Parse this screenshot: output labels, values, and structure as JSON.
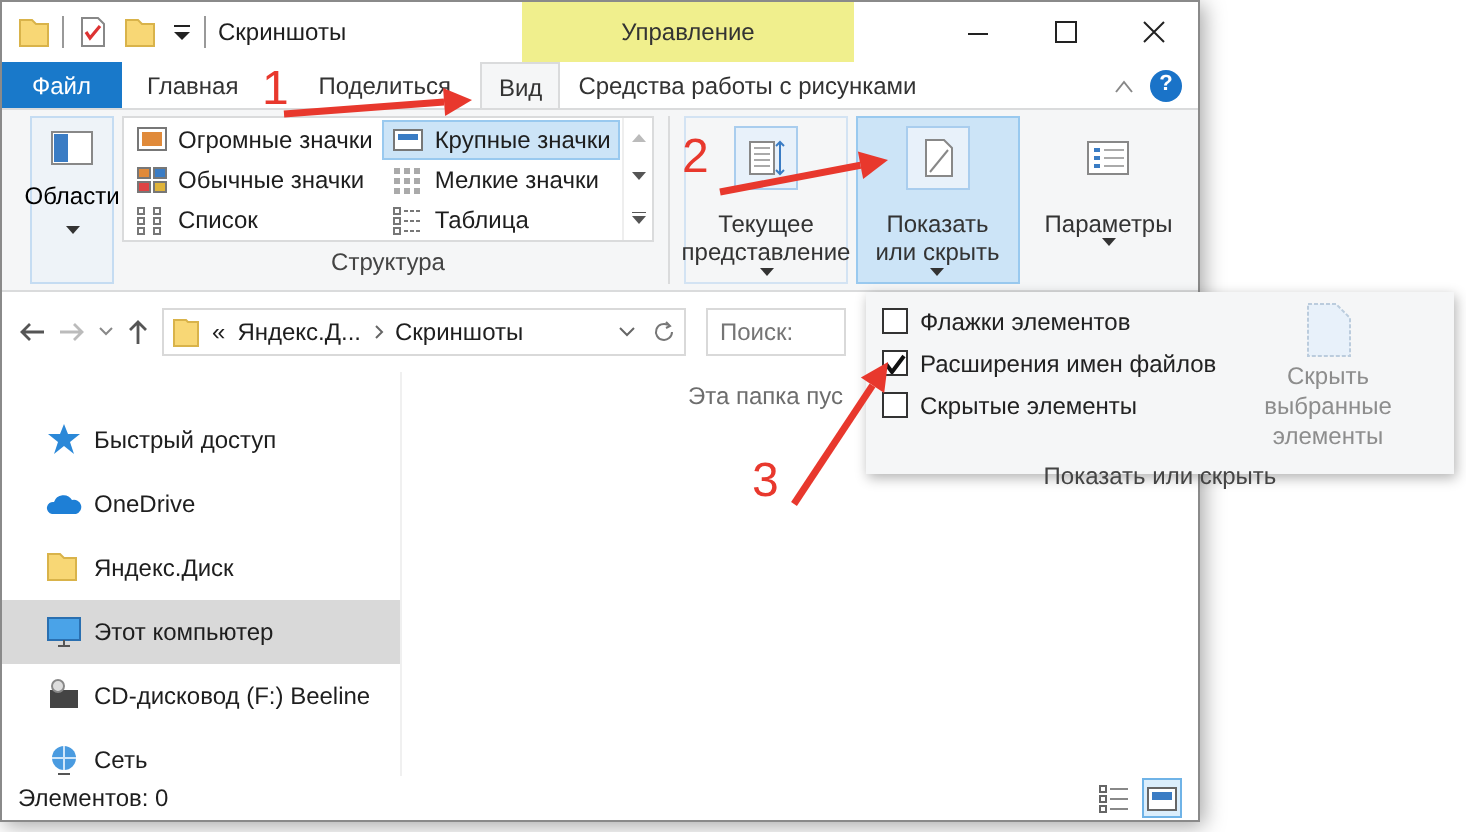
{
  "title_bar": {
    "title": "Скриншоты",
    "context_tab": "Управление"
  },
  "ribbon_tabs": [
    {
      "label": "Файл",
      "kind": "file",
      "selected": false
    },
    {
      "label": "Главная",
      "kind": "tab",
      "selected": false
    },
    {
      "label": "Поделиться",
      "kind": "tab",
      "selected": false
    },
    {
      "label": "Вид",
      "kind": "tab",
      "selected": true
    },
    {
      "label": "Средства работы с рисунками",
      "kind": "tab",
      "selected": false
    }
  ],
  "help": "?",
  "ribbon": {
    "panes_button": {
      "label": "Области"
    },
    "layout_items": [
      {
        "label": "Огромные значки",
        "selected": false
      },
      {
        "label": "Крупные значки",
        "selected": true
      },
      {
        "label": "Обычные значки",
        "selected": false
      },
      {
        "label": "Мелкие значки",
        "selected": false
      },
      {
        "label": "Список",
        "selected": false
      },
      {
        "label": "Таблица",
        "selected": false
      }
    ],
    "layout_group": "Структура",
    "buttons": [
      {
        "label": "Текущее представление",
        "kind": "view",
        "pressed": false
      },
      {
        "label": "Показать или скрыть",
        "kind": "show",
        "pressed": true
      },
      {
        "label": "Параметры",
        "kind": "options",
        "pressed": false
      }
    ]
  },
  "address_bar": {
    "overflow": "«",
    "crumbs": [
      "Яндекс.Д...",
      "Скриншоты"
    ],
    "search_placeholder": "Поиск:"
  },
  "nav_items": [
    {
      "label": "Быстрый доступ",
      "kind": "star",
      "selected": false
    },
    {
      "label": "OneDrive",
      "kind": "cloud",
      "selected": false
    },
    {
      "label": "Яндекс.Диск",
      "kind": "folder",
      "selected": false
    },
    {
      "label": "Этот компьютер",
      "kind": "computer",
      "selected": true
    },
    {
      "label": "CD-дисковод (F:) Beeline",
      "kind": "drive",
      "selected": false
    },
    {
      "label": "Сеть",
      "kind": "network",
      "selected": false
    }
  ],
  "content": {
    "empty_text": "Эта папка пус"
  },
  "status_bar": {
    "items_count": "Элементов: 0",
    "views": [
      {
        "kind": "details",
        "selected": false
      },
      {
        "kind": "large",
        "selected": true
      }
    ]
  },
  "popup": {
    "checkboxes": [
      {
        "label": "Флажки элементов",
        "checked": false
      },
      {
        "label": "Расширения имен файлов",
        "checked": true
      },
      {
        "label": "Скрытые элементы",
        "checked": false
      }
    ],
    "hide_selected": {
      "label": "Скрыть выбранные элементы",
      "disabled": true
    },
    "group": "Показать или скрыть"
  },
  "annotations": [
    {
      "label": "1"
    },
    {
      "label": "2"
    },
    {
      "label": "3"
    }
  ]
}
